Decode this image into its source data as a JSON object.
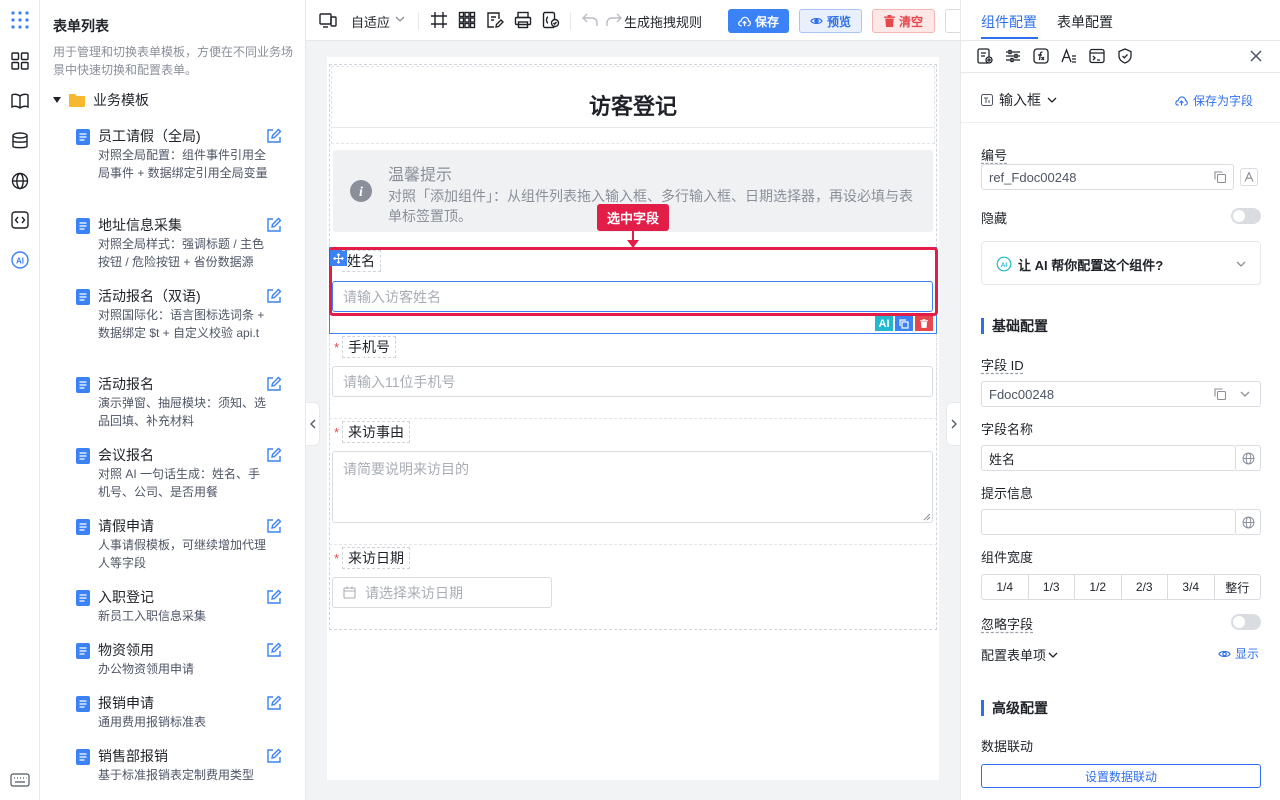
{
  "left_panel": {
    "title": "表单列表",
    "description": "用于管理和切换表单模板，方便在不同业务场景中快速切换和配置表单。",
    "folder": "业务模板",
    "templates": [
      {
        "name": "员工请假（全局)",
        "desc": "对照全局配置：组件事件引用全局事件 + 数据绑定引用全局变量"
      },
      {
        "name": "地址信息采集",
        "desc": "对照全局样式：强调标题 / 主色按钮 / 危险按钮 + 省份数据源"
      },
      {
        "name": "活动报名（双语)",
        "desc": "对照国际化：语言图标选词条 + 数据绑定 $t + 自定义校验 api.t"
      },
      {
        "name": "活动报名",
        "desc": "演示弹窗、抽屉模块：须知、选品回填、补充材料"
      },
      {
        "name": "会议报名",
        "desc": "对照 AI 一句话生成：姓名、手机号、公司、是否用餐"
      },
      {
        "name": "请假申请",
        "desc": "人事请假模板，可继续增加代理人等字段"
      },
      {
        "name": "入职登记",
        "desc": "新员工入职信息采集"
      },
      {
        "name": "物资领用",
        "desc": "办公物资领用申请"
      },
      {
        "name": "报销申请",
        "desc": "通用费用报销标准表"
      },
      {
        "name": "销售部报销",
        "desc": "基于标准报销表定制费用类型"
      }
    ]
  },
  "toolbar": {
    "adaptive": "自适应",
    "generate_rules": "生成拖拽规则",
    "save": "保存",
    "preview": "预览",
    "clear": "清空",
    "colors": {
      "save": "#3b82f6",
      "preview_bg": "#e8f0fe",
      "clear_bg": "#fde8e8",
      "danger": "#e5484d"
    }
  },
  "form": {
    "title": "访客登记",
    "tip_title": "温馨提示",
    "tip_text": "对照「添加组件」：从组件列表拖入输入框、多行输入框、日期选择器，再设必填与表单标签置顶。",
    "selected_badge": "选中字段",
    "fields": [
      {
        "label": "姓名",
        "placeholder": "请输入访客姓名",
        "required": false
      },
      {
        "label": "手机号",
        "placeholder": "请输入11位手机号",
        "required": true
      },
      {
        "label": "来访事由",
        "placeholder": "请简要说明来访目的",
        "required": true
      },
      {
        "label": "来访日期",
        "placeholder": "请选择来访日期",
        "required": true
      }
    ],
    "ai_chip": "AI"
  },
  "right_panel": {
    "tabs": [
      "组件配置",
      "表单配置"
    ],
    "component_type": "输入框",
    "save_as_field": "保存为字段",
    "ref_label": "编号",
    "ref_value": "ref_Fdoc00248",
    "hidden_label": "隐藏",
    "ai_prompt": "让 AI 帮你配置这个组件?",
    "basic_section": "基础配置",
    "field_id_label": "字段 ID",
    "field_id_value": "Fdoc00248",
    "field_name_label": "字段名称",
    "field_name_value": "姓名",
    "hint_label": "提示信息",
    "hint_value": "",
    "width_label": "组件宽度",
    "width_options": [
      "1/4",
      "1/3",
      "1/2",
      "2/3",
      "3/4",
      "整行"
    ],
    "ignore_label": "忽略字段",
    "form_items_label": "配置表单项",
    "show_label": "显示",
    "advanced_section": "高级配置",
    "linkage_label": "数据联动",
    "linkage_button": "设置数据联动"
  }
}
